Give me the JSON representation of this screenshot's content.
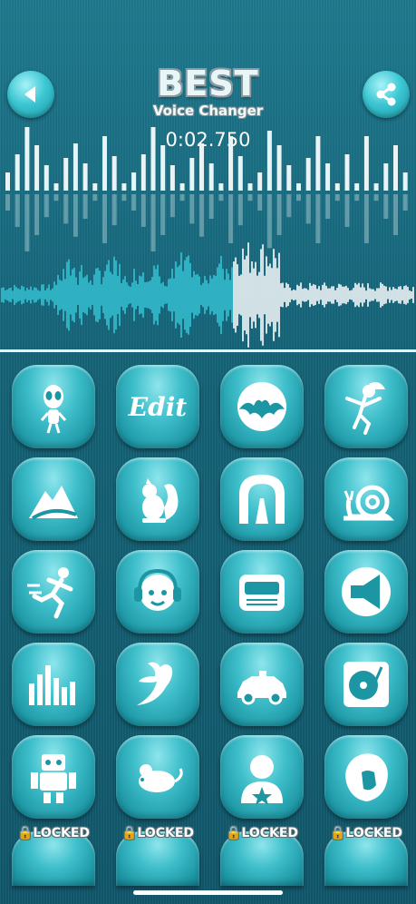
{
  "header": {
    "title": "BEST",
    "subtitle": "Voice Changer",
    "timer": "0:02.750"
  },
  "effects": [
    {
      "name": "alien",
      "icon": "alien-icon",
      "locked": false
    },
    {
      "name": "edit",
      "label": "Edit",
      "icon": "edit-text",
      "locked": false
    },
    {
      "name": "bat",
      "icon": "bat-icon",
      "locked": false
    },
    {
      "name": "zombie",
      "icon": "zombie-icon",
      "locked": false
    },
    {
      "name": "mountain",
      "icon": "mountain-icon",
      "locked": false
    },
    {
      "name": "squirrel",
      "icon": "squirrel-icon",
      "locked": false
    },
    {
      "name": "tunnel",
      "icon": "tunnel-icon",
      "locked": false
    },
    {
      "name": "snail",
      "icon": "snail-icon",
      "locked": false
    },
    {
      "name": "fast",
      "icon": "running-man-icon",
      "locked": false
    },
    {
      "name": "kid",
      "icon": "kid-headphones-icon",
      "locked": false
    },
    {
      "name": "radio",
      "icon": "radio-icon",
      "locked": false
    },
    {
      "name": "megaphone",
      "icon": "megaphone-icon",
      "locked": false
    },
    {
      "name": "equalizer",
      "icon": "equalizer-icon",
      "locked": false
    },
    {
      "name": "bird",
      "icon": "bird-icon",
      "locked": false
    },
    {
      "name": "police",
      "icon": "police-car-icon",
      "locked": false
    },
    {
      "name": "turntable",
      "icon": "turntable-icon",
      "locked": false
    },
    {
      "name": "robot",
      "icon": "robot-icon",
      "locked": false
    },
    {
      "name": "mouse",
      "icon": "mouse-icon",
      "locked": false
    },
    {
      "name": "hero",
      "icon": "hero-icon",
      "locked": false
    },
    {
      "name": "lion",
      "icon": "lion-icon",
      "locked": false
    }
  ],
  "locked_labels": [
    "LOCKED",
    "LOCKED",
    "LOCKED",
    "LOCKED"
  ],
  "colors": {
    "accent": "#3fbfcb",
    "wave_played": "#35c4d4",
    "wave_remaining": "#ffffff"
  }
}
